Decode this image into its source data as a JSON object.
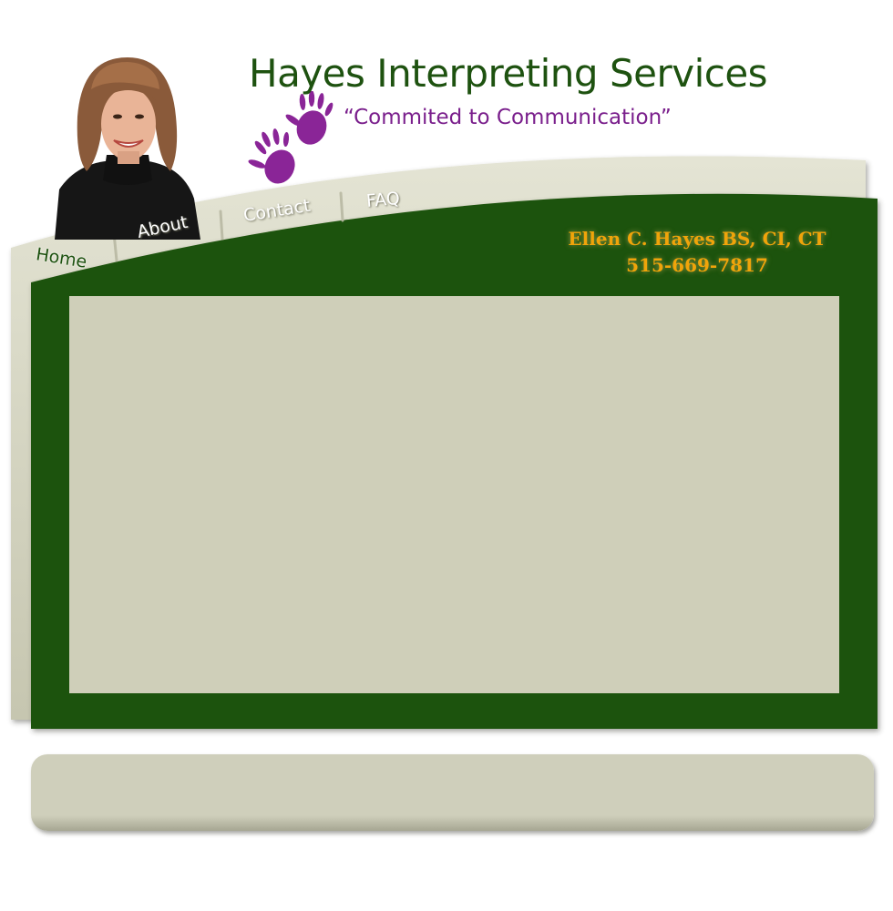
{
  "header": {
    "site_title": "Hayes Interpreting Services",
    "tagline": "“Commited to Communication”"
  },
  "nav": {
    "items": [
      {
        "label": "Home"
      },
      {
        "label": "About"
      },
      {
        "label": "Contact"
      },
      {
        "label": "FAQ"
      }
    ]
  },
  "contact": {
    "name": "Ellen C. Hayes BS, CI, CT",
    "phone": "515-669-7817"
  },
  "colors": {
    "frame_green": "#1e5210",
    "panel_beige": "#cfcfb9",
    "tagline_purple": "#7a1f8c",
    "contact_gold": "#f0a40a"
  },
  "icons": {
    "handprints": "purple-handprints-icon",
    "portrait": "woman-portrait-photo"
  }
}
